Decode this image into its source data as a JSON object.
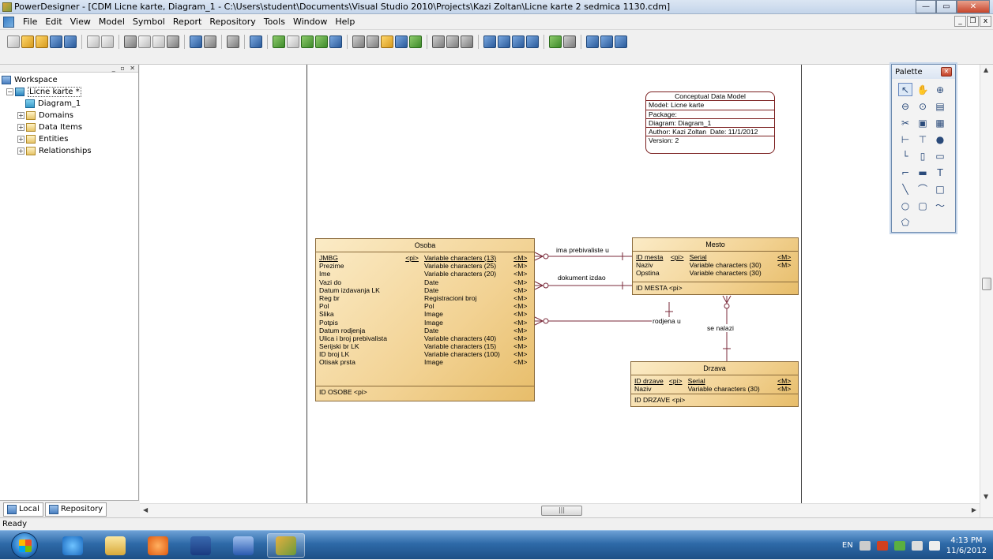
{
  "window": {
    "title": "PowerDesigner - [CDM Licne karte, Diagram_1 - C:\\Users\\student\\Documents\\Visual Studio 2010\\Projects\\Kazi Zoltan\\Licne karte 2 sedmica 1130.cdm]"
  },
  "menu": [
    "File",
    "Edit",
    "View",
    "Model",
    "Symbol",
    "Report",
    "Repository",
    "Tools",
    "Window",
    "Help"
  ],
  "tree": {
    "workspace": "Workspace",
    "model": "Licne karte *",
    "diagram": "Diagram_1",
    "folders": [
      "Domains",
      "Data Items",
      "Entities",
      "Relationships"
    ]
  },
  "tabs": {
    "local": "Local",
    "repository": "Repository"
  },
  "model_info": {
    "title": "Conceptual Data Model",
    "model": "Model: Licne karte",
    "package": "Package:",
    "diagram": "Diagram: Diagram_1",
    "author": "Author: Kazi Zoltan",
    "date": "Date: 11/1/2012",
    "version": "Version: 2"
  },
  "entities": {
    "osoba": {
      "name": "Osoba",
      "attributes": [
        {
          "name": "JMBG",
          "pi": "<pi>",
          "type": "Variable characters (13)",
          "m": "<M>",
          "key": true
        },
        {
          "name": "Prezime",
          "pi": "",
          "type": "Variable characters (25)",
          "m": "<M>",
          "key": false
        },
        {
          "name": "Ime",
          "pi": "",
          "type": "Variable characters (20)",
          "m": "<M>",
          "key": false
        },
        {
          "name": "Vazi do",
          "pi": "",
          "type": "Date",
          "m": "<M>",
          "key": false
        },
        {
          "name": "Datum izdavanja LK",
          "pi": "",
          "type": "Date",
          "m": "<M>",
          "key": false
        },
        {
          "name": "Reg br",
          "pi": "",
          "type": "Registracioni broj",
          "m": "<M>",
          "key": false
        },
        {
          "name": "Pol",
          "pi": "",
          "type": "Pol",
          "m": "<M>",
          "key": false
        },
        {
          "name": "Slika",
          "pi": "",
          "type": "Image",
          "m": "<M>",
          "key": false
        },
        {
          "name": "Potpis",
          "pi": "",
          "type": "Image",
          "m": "<M>",
          "key": false
        },
        {
          "name": "Datum rodjenja",
          "pi": "",
          "type": "Date",
          "m": "<M>",
          "key": false
        },
        {
          "name": "Ulica i broj prebivalista",
          "pi": "",
          "type": "Variable characters (40)",
          "m": "<M>",
          "key": false
        },
        {
          "name": "Serijski br LK",
          "pi": "",
          "type": "Variable characters (15)",
          "m": "<M>",
          "key": false
        },
        {
          "name": "ID broj LK",
          "pi": "",
          "type": "Variable characters (100)",
          "m": "<M>",
          "key": false
        },
        {
          "name": "Otisak prsta",
          "pi": "",
          "type": "Image",
          "m": "<M>",
          "key": false
        }
      ],
      "identifier": "ID OSOBE  <pi>"
    },
    "mesto": {
      "name": "Mesto",
      "attributes": [
        {
          "name": "ID mesta",
          "pi": "<pi>",
          "type": "Serial",
          "m": "<M>",
          "key": true
        },
        {
          "name": "Naziv",
          "pi": "",
          "type": "Variable characters (30)",
          "m": "<M>",
          "key": false
        },
        {
          "name": "Opstina",
          "pi": "",
          "type": "Variable characters (30)",
          "m": "",
          "key": false
        }
      ],
      "identifier": "ID MESTA  <pi>"
    },
    "drzava": {
      "name": "Drzava",
      "attributes": [
        {
          "name": "ID drzave",
          "pi": "<pi>",
          "type": "Serial",
          "m": "<M>",
          "key": true
        },
        {
          "name": "Naziv",
          "pi": "",
          "type": "Variable characters (30)",
          "m": "<M>",
          "key": false
        }
      ],
      "identifier": "ID DRZAVE  <pi>"
    }
  },
  "relationships": {
    "r1": "ima prebivaliste u",
    "r2": "dokument izdao",
    "r3": "rodjena u",
    "r4": "se nalazi"
  },
  "palette": {
    "title": "Palette"
  },
  "status": "Ready",
  "clock": {
    "time": "4:13 PM",
    "date": "11/6/2012"
  },
  "tray": {
    "lang": "EN"
  }
}
